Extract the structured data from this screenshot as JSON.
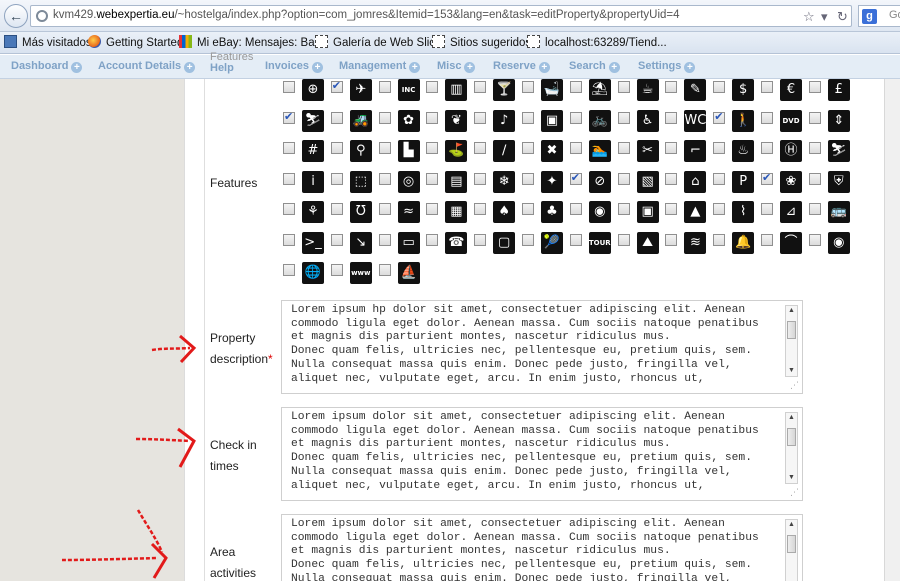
{
  "browser": {
    "url_prefix": "kvm429.",
    "url_domain": "webexpertia.eu",
    "url_rest": "/~hostelga/index.php?option=com_jomres&Itemid=153&lang=en&task=editProperty&propertyUid=4",
    "search_label": "Go",
    "bookmarks": [
      "Más visitados",
      "Getting Started",
      "Mi eBay: Mensajes: Ba...",
      "Galería de Web Slice",
      "Sitios sugeridos",
      "localhost:63289/Tiend..."
    ]
  },
  "admin_nav": {
    "items": [
      "Dashboard",
      "Account Details",
      "Invoices",
      "Management",
      "Misc",
      "Reserve",
      "Search",
      "Settings"
    ],
    "ghost_label": "Features",
    "help_label": "Help"
  },
  "form": {
    "features_label": "Features",
    "property_description": {
      "label_line1": "Property",
      "label_line2": "description",
      "required_mark": "*",
      "value": "Lorem ipsum hp dolor sit amet, consectetuer adipiscing elit. Aenean\ncommodo ligula eget dolor. Aenean massa. Cum sociis natoque penatibus\net magnis dis parturient montes, nascetur ridiculus mus.\nDonec quam felis, ultricies nec, pellentesque eu, pretium quis, sem.\nNulla consequat massa quis enim. Donec pede justo, fringilla vel,\naliquet nec, vulputate eget, arcu. In enim justo, rhoncus ut,"
    },
    "check_in_times": {
      "label_line1": "Check in",
      "label_line2": "times",
      "value": "Lorem ipsum dolor sit amet, consectetuer adipiscing elit. Aenean\ncommodo ligula eget dolor. Aenean massa. Cum sociis natoque penatibus\net magnis dis parturient montes, nascetur ridiculus mus.\nDonec quam felis, ultricies nec, pellentesque eu, pretium quis, sem.\nNulla consequat massa quis enim. Donec pede justo, fringilla vel,\naliquet nec, vulputate eget, arcu. In enim justo, rhoncus ut,"
    },
    "area_activities": {
      "label_line1": "Area",
      "label_line2": "activities",
      "value": "Lorem ipsum dolor sit amet, consectetuer adipiscing elit. Aenean\ncommodo ligula eget dolor. Aenean massa. Cum sociis natoque penatibus\net magnis dis parturient montes, nascetur ridiculus mus.\nDonec quam felis, ultricies nec, pellentesque eu, pretium quis, sem.\nNulla consequat massa quis enim. Donec pede justo, fringilla vel,"
    }
  },
  "feature_icons": [
    [
      {
        "icon": "compass-icon",
        "g": "⊕",
        "c": false
      },
      {
        "icon": "airplane-icon",
        "g": "✈",
        "c": true
      },
      {
        "icon": "inc-icon",
        "g": "INC",
        "c": false
      },
      {
        "icon": "library-icon",
        "g": "▥",
        "c": false
      },
      {
        "icon": "bar-icon",
        "g": "🍸",
        "c": false
      },
      {
        "icon": "bath-icon",
        "g": "🛁",
        "c": false
      },
      {
        "icon": "beach-icon",
        "g": "⛱",
        "c": false
      },
      {
        "icon": "teapot-icon",
        "g": "☕",
        "c": false
      },
      {
        "icon": "feather-icon",
        "g": "✎",
        "c": false
      },
      {
        "icon": "dollar-icon",
        "g": "$",
        "c": false
      },
      {
        "icon": "euro-icon",
        "g": "€",
        "c": false
      },
      {
        "icon": "pound-icon",
        "g": "£",
        "c": false
      }
    ],
    [
      {
        "icon": "ski-icon",
        "g": "⛷",
        "c": true
      },
      {
        "icon": "tractor-icon",
        "g": "🚜",
        "c": false
      },
      {
        "icon": "butterfly-icon",
        "g": "✿",
        "c": false
      },
      {
        "icon": "plant-icon",
        "g": "❦",
        "c": false
      },
      {
        "icon": "music-icon",
        "g": "♪",
        "c": false
      },
      {
        "icon": "suitcase-icon",
        "g": "▣",
        "c": false
      },
      {
        "icon": "bicycle-icon",
        "g": "🚲",
        "c": false
      },
      {
        "icon": "wheelchair-icon",
        "g": "♿",
        "c": false
      },
      {
        "icon": "toilet-icon",
        "g": "WC",
        "c": false
      },
      {
        "icon": "blind-person-icon",
        "g": "🚶",
        "c": true
      },
      {
        "icon": "dvd-icon",
        "g": "DVD",
        "c": false
      },
      {
        "icon": "elevator-icon",
        "g": "⇕",
        "c": false
      }
    ],
    [
      {
        "icon": "grid-icon",
        "g": "#",
        "c": false
      },
      {
        "icon": "stroller-icon",
        "g": "⚲",
        "c": false
      },
      {
        "icon": "factory-icon",
        "g": "▙",
        "c": false
      },
      {
        "icon": "golf-icon",
        "g": "⛳",
        "c": false
      },
      {
        "icon": "hockey-icon",
        "g": "∕",
        "c": false
      },
      {
        "icon": "tools-icon",
        "g": "✖",
        "c": false
      },
      {
        "icon": "swimmer-icon",
        "g": "🏊",
        "c": false
      },
      {
        "icon": "scissors-icon",
        "g": "✂",
        "c": false
      },
      {
        "icon": "hairdryer-icon",
        "g": "⌐",
        "c": false
      },
      {
        "icon": "sauna-icon",
        "g": "♨",
        "c": false
      },
      {
        "icon": "hospital-icon",
        "g": "Ⓗ",
        "c": false
      },
      {
        "icon": "hiking-icon",
        "g": "⛷",
        "c": false
      }
    ],
    [
      {
        "icon": "info-icon",
        "g": "i",
        "c": false
      },
      {
        "icon": "ticket-icon",
        "g": "⬚",
        "c": false
      },
      {
        "icon": "spiral-icon",
        "g": "◎",
        "c": false
      },
      {
        "icon": "map-icon",
        "g": "▤",
        "c": false
      },
      {
        "icon": "snowflake-icon",
        "g": "❄",
        "c": false
      },
      {
        "icon": "child-play-icon",
        "g": "✦",
        "c": false
      },
      {
        "icon": "no-smoking-icon",
        "g": "⊘",
        "c": true
      },
      {
        "icon": "notes-icon",
        "g": "▧",
        "c": false
      },
      {
        "icon": "home-icon",
        "g": "⌂",
        "c": false
      },
      {
        "icon": "parking-icon",
        "g": "P",
        "c": false
      },
      {
        "icon": "pets-icon",
        "g": "❀",
        "c": true
      },
      {
        "icon": "picnic-icon",
        "g": "⛨",
        "c": false
      }
    ],
    [
      {
        "icon": "playground-icon",
        "g": "⚘",
        "c": false
      },
      {
        "icon": "horseshoe-icon",
        "g": "Ʊ",
        "c": false
      },
      {
        "icon": "pool-icon",
        "g": "≈",
        "c": false
      },
      {
        "icon": "fence-icon",
        "g": "▦",
        "c": false
      },
      {
        "icon": "tree-icon",
        "g": "♠",
        "c": false
      },
      {
        "icon": "forest-icon",
        "g": "♣",
        "c": false
      },
      {
        "icon": "restaurant-icon",
        "g": "◉",
        "c": false
      },
      {
        "icon": "safe-icon",
        "g": "▣",
        "c": false
      },
      {
        "icon": "mountain-icon",
        "g": "▲",
        "c": false
      },
      {
        "icon": "shower-icon",
        "g": "⌇",
        "c": false
      },
      {
        "icon": "ski-lift-icon",
        "g": "⊿",
        "c": false
      },
      {
        "icon": "bus-icon",
        "g": "🚌",
        "c": false
      }
    ],
    [
      {
        "icon": "terminal-icon",
        "g": ">_",
        "c": false
      },
      {
        "icon": "diving-icon",
        "g": "↘",
        "c": false
      },
      {
        "icon": "credit-card-icon",
        "g": "▭",
        "c": false
      },
      {
        "icon": "telephone-icon",
        "g": "☎",
        "c": false
      },
      {
        "icon": "tv-icon",
        "g": "▢",
        "c": false
      },
      {
        "icon": "tennis-icon",
        "g": "🎾",
        "c": false
      },
      {
        "icon": "tour-icon",
        "g": "TOUR",
        "c": false
      },
      {
        "icon": "trekking-icon",
        "g": "⛰",
        "c": false
      },
      {
        "icon": "water-icon",
        "g": "≋",
        "c": false
      },
      {
        "icon": "bell-icon",
        "g": "🔔",
        "c": false
      },
      {
        "icon": "lake-icon",
        "g": "⌒",
        "c": false
      },
      {
        "icon": "wifi-icon",
        "g": "◉",
        "c": false
      }
    ],
    [
      {
        "icon": "globe-icon",
        "g": "🌐",
        "c": false
      },
      {
        "icon": "www-icon",
        "g": "www",
        "c": false
      },
      {
        "icon": "boat-icon",
        "g": "⛵",
        "c": false
      }
    ]
  ]
}
